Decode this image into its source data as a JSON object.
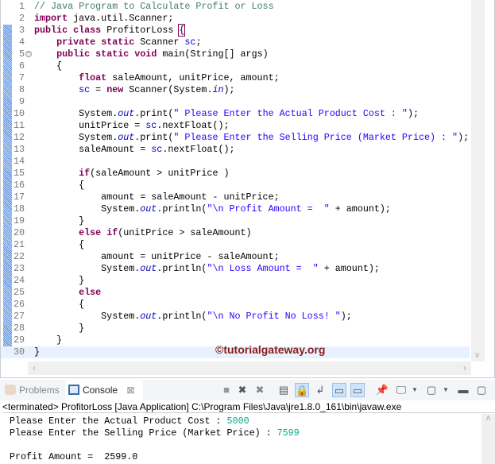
{
  "editor": {
    "lines": [
      [
        [
          "// Java Program to Calculate Profit or Loss",
          "cm"
        ]
      ],
      [
        [
          "import",
          "kw"
        ],
        [
          " java.util.Scanner;",
          ""
        ]
      ],
      [
        [
          "public",
          "kw"
        ],
        [
          " ",
          ""
        ],
        [
          "class",
          "kw"
        ],
        [
          " ProfitorLoss ",
          ""
        ],
        [
          "{",
          "brk"
        ]
      ],
      [
        [
          "    ",
          ""
        ],
        [
          "private",
          "kw"
        ],
        [
          " ",
          ""
        ],
        [
          "static",
          "kw"
        ],
        [
          " Scanner ",
          ""
        ],
        [
          "sc",
          "fld"
        ],
        [
          ";",
          ""
        ]
      ],
      [
        [
          "    ",
          ""
        ],
        [
          "public",
          "kw"
        ],
        [
          " ",
          ""
        ],
        [
          "static",
          "kw"
        ],
        [
          " ",
          ""
        ],
        [
          "void",
          "kw"
        ],
        [
          " main(String[] args)",
          ""
        ]
      ],
      [
        [
          "    {",
          ""
        ]
      ],
      [
        [
          "        ",
          ""
        ],
        [
          "float",
          "kw"
        ],
        [
          " saleAmount, unitPrice, amount;",
          ""
        ]
      ],
      [
        [
          "        ",
          ""
        ],
        [
          "sc",
          "fld"
        ],
        [
          " = ",
          ""
        ],
        [
          "new",
          "kw"
        ],
        [
          " Scanner(System.",
          ""
        ],
        [
          "in",
          "sf"
        ],
        [
          ");",
          ""
        ]
      ],
      [],
      [
        [
          "        System.",
          ""
        ],
        [
          "out",
          "sf"
        ],
        [
          ".print(",
          ""
        ],
        [
          "\" Please Enter the Actual Product Cost : \"",
          "st"
        ],
        [
          ");",
          ""
        ]
      ],
      [
        [
          "        unitPrice = ",
          ""
        ],
        [
          "sc",
          "fld"
        ],
        [
          ".nextFloat();",
          ""
        ]
      ],
      [
        [
          "        System.",
          ""
        ],
        [
          "out",
          "sf"
        ],
        [
          ".print(",
          ""
        ],
        [
          "\" Please Enter the Selling Price (Market Price) : \"",
          "st"
        ],
        [
          ");",
          ""
        ]
      ],
      [
        [
          "        saleAmount = ",
          ""
        ],
        [
          "sc",
          "fld"
        ],
        [
          ".nextFloat();",
          ""
        ]
      ],
      [],
      [
        [
          "        ",
          ""
        ],
        [
          "if",
          "kw"
        ],
        [
          "(saleAmount > unitPrice )",
          ""
        ]
      ],
      [
        [
          "        {",
          ""
        ]
      ],
      [
        [
          "            amount = saleAmount - unitPrice;",
          ""
        ]
      ],
      [
        [
          "            System.",
          ""
        ],
        [
          "out",
          "sf"
        ],
        [
          ".println(",
          ""
        ],
        [
          "\"\\n Profit Amount =  \"",
          "st"
        ],
        [
          " + amount);",
          ""
        ]
      ],
      [
        [
          "        }",
          ""
        ]
      ],
      [
        [
          "        ",
          ""
        ],
        [
          "else",
          "kw"
        ],
        [
          " ",
          ""
        ],
        [
          "if",
          "kw"
        ],
        [
          "(unitPrice > saleAmount)",
          ""
        ]
      ],
      [
        [
          "        {",
          ""
        ]
      ],
      [
        [
          "            amount = unitPrice - saleAmount;",
          ""
        ]
      ],
      [
        [
          "            System.",
          ""
        ],
        [
          "out",
          "sf"
        ],
        [
          ".println(",
          ""
        ],
        [
          "\"\\n Loss Amount =  \"",
          "st"
        ],
        [
          " + amount);",
          ""
        ]
      ],
      [
        [
          "        }",
          ""
        ]
      ],
      [
        [
          "        ",
          ""
        ],
        [
          "else",
          "kw"
        ]
      ],
      [
        [
          "        {",
          ""
        ]
      ],
      [
        [
          "            System.",
          ""
        ],
        [
          "out",
          "sf"
        ],
        [
          ".println(",
          ""
        ],
        [
          "\"\\n No Profit No Loss! \"",
          "st"
        ],
        [
          ");",
          ""
        ]
      ],
      [
        [
          "        }",
          ""
        ]
      ],
      [
        [
          "    }",
          ""
        ]
      ],
      [
        [
          "}",
          ""
        ]
      ]
    ],
    "watermark": "©tutorialgateway.org"
  },
  "panel": {
    "tabs": [
      {
        "label": "Problems"
      },
      {
        "label": "Console"
      }
    ],
    "close_glyph": "⊠",
    "status": "<terminated> ProfitorLoss [Java Application] C:\\Program Files\\Java\\jre1.8.0_161\\bin\\javaw.exe",
    "console": [
      {
        "text": "Please Enter the Actual Product Cost : ",
        "input": "5000"
      },
      {
        "text": "Please Enter the Selling Price (Market Price) : ",
        "input": "7599"
      },
      {
        "text": "",
        "input": ""
      },
      {
        "text": "Profit Amount =  2599.0",
        "input": ""
      }
    ]
  }
}
